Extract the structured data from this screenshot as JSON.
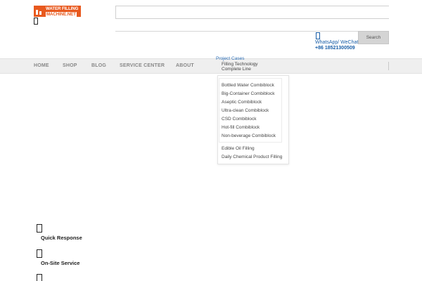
{
  "header": {
    "logo_line1": "WATER FILLING",
    "logo_line2": "MACHINE.NET",
    "search_placeholder": "",
    "search_button": "Search",
    "whatsapp_label": "WhatsApp/ WeChat",
    "phone": "+86 18521300509",
    "accent_color": "#1a5fa8",
    "brand_color": "#e8591e"
  },
  "nav": {
    "items": [
      {
        "label": "HOME"
      },
      {
        "label": "SHOP"
      },
      {
        "label": "BLOG"
      },
      {
        "label": "SERVICE CENTER"
      },
      {
        "label": "ABOUT"
      }
    ]
  },
  "menu": {
    "project_cases": "Project Cases",
    "filling_technology": "Filling Technology",
    "complete_line": "Complete Line",
    "combiblock_items": [
      "Bottled Water Combiblock",
      "Big-Container Combiblock",
      "Aseptic Combiblock",
      "Ultra-clean Combiblock",
      "CSD Combiblock",
      "Hot-fill Combiblock",
      "Non-beverage Combiblock"
    ],
    "other_items": [
      "Edible Oil Filling",
      "Daily Chemical Product Filling"
    ]
  },
  "features": [
    {
      "label": "Quick Response"
    },
    {
      "label": "On-Site Service"
    }
  ]
}
